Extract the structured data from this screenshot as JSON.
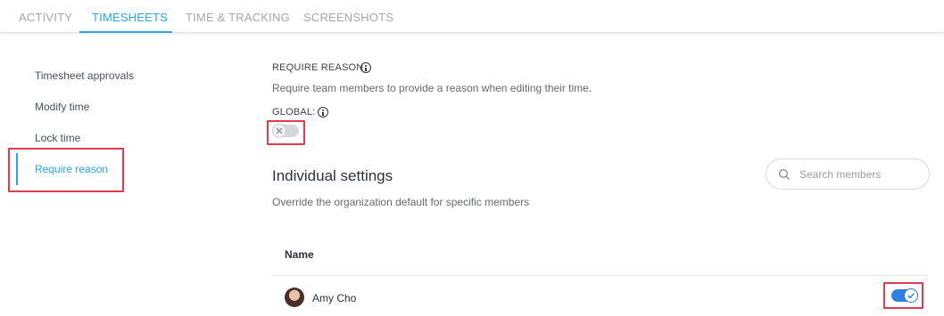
{
  "tabs": [
    {
      "label": "ACTIVITY",
      "active": false
    },
    {
      "label": "TIMESHEETS",
      "active": true
    },
    {
      "label": "TIME & TRACKING",
      "active": false
    },
    {
      "label": "SCREENSHOTS",
      "active": false
    }
  ],
  "sidebar": {
    "items": [
      {
        "label": "Timesheet approvals",
        "active": false
      },
      {
        "label": "Modify time",
        "active": false
      },
      {
        "label": "Lock time",
        "active": false
      },
      {
        "label": "Require reason",
        "active": true
      }
    ]
  },
  "main": {
    "section_title": "REQUIRE REASON",
    "section_description": "Require team members to provide a reason when editing their time.",
    "global_label": "GLOBAL:",
    "global_enabled": false,
    "individual_title": "Individual settings",
    "individual_description": "Override the organization default for specific members",
    "search_placeholder": "Search members",
    "table": {
      "columns": [
        "Name"
      ],
      "rows": [
        {
          "name": "Amy Cho",
          "enabled": true
        }
      ]
    }
  },
  "colors": {
    "accent": "#2aa3e8",
    "toggle_on": "#2f7fe0",
    "highlight": "#e23b4b"
  },
  "icons": {
    "info": "info-icon",
    "search": "search-icon",
    "toggle_off": "x-icon",
    "toggle_on": "check-icon"
  }
}
